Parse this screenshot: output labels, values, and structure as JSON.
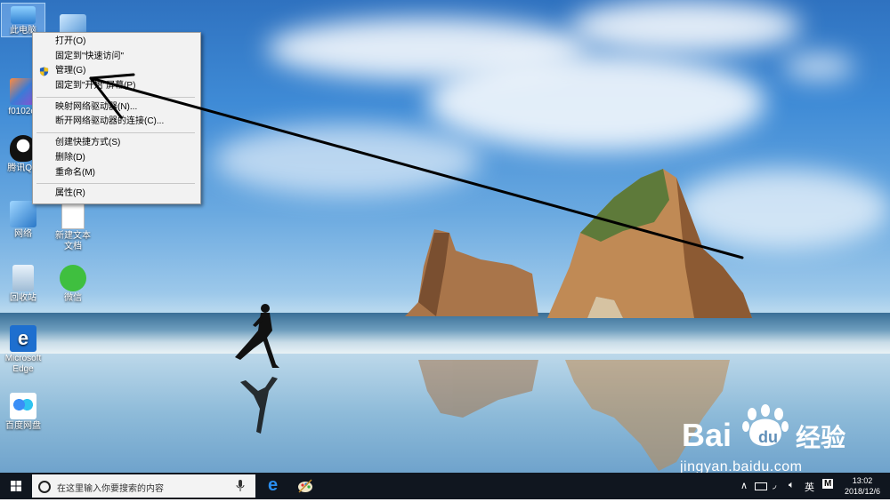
{
  "desktop_icons": [
    {
      "label": "此电脑"
    },
    {
      "label": ""
    },
    {
      "label": "f0102ef"
    },
    {
      "label": "腾讯QQ"
    },
    {
      "label": "网络"
    },
    {
      "label": "新建文本文档"
    },
    {
      "label": "回收站"
    },
    {
      "label": "微信"
    },
    {
      "label": "Microsoft Edge"
    },
    {
      "label": "百度网盘"
    }
  ],
  "context_menu": {
    "items": [
      {
        "label": "打开(O)"
      },
      {
        "label": "固定到\"快速访问\""
      },
      {
        "label": "管理(G)",
        "icon": "uac-shield-icon"
      },
      {
        "label": "固定到\"开始\"屏幕(P)"
      },
      {
        "label": "映射网络驱动器(N)..."
      },
      {
        "label": "断开网络驱动器的连接(C)..."
      },
      {
        "label": "创建快捷方式(S)"
      },
      {
        "label": "删除(D)"
      },
      {
        "label": "重命名(M)"
      },
      {
        "label": "属性(R)"
      }
    ]
  },
  "taskbar": {
    "search_placeholder": "在这里输入你要搜索的内容",
    "ime": "英",
    "ime_mode": "M",
    "time": "13:02",
    "date": "2018/12/6"
  },
  "watermark": {
    "brand": "Bai经验",
    "url": "jingyan.baidu.com"
  },
  "colors": {
    "taskbar": "#10161f",
    "menu_bg": "#f2f2f2",
    "edge_blue": "#1e6fcf"
  }
}
